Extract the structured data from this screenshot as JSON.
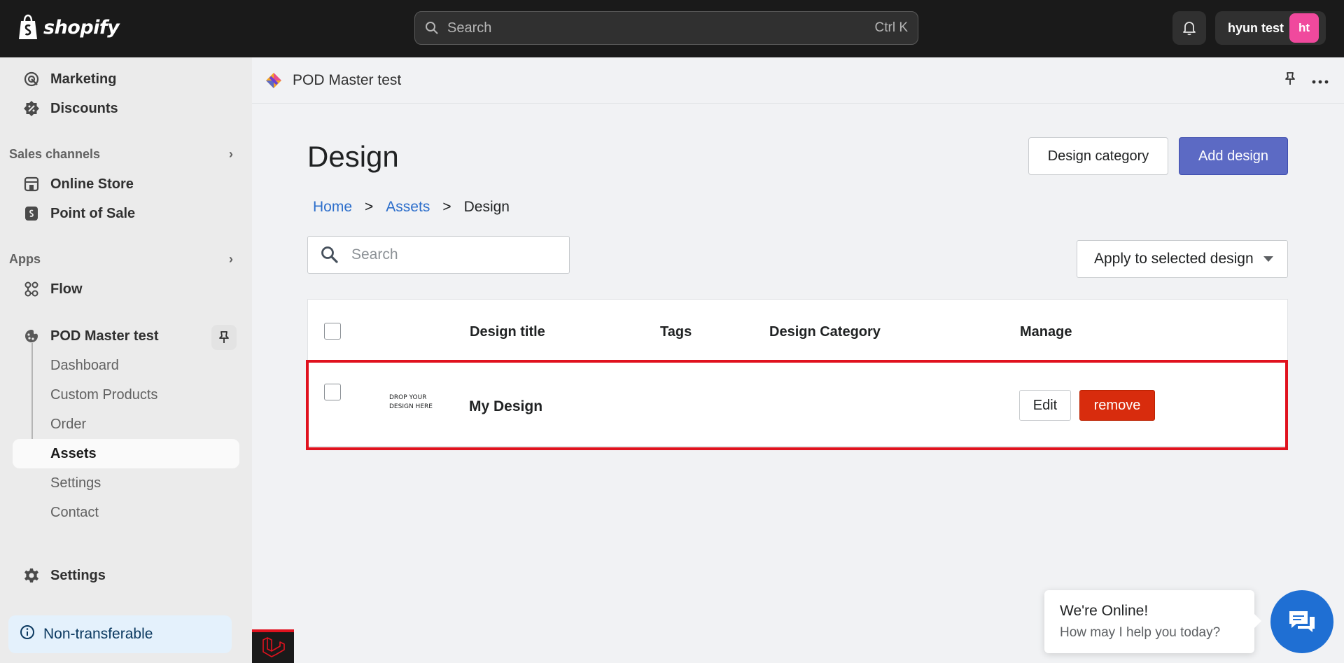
{
  "topbar": {
    "brand": "shopify",
    "search_placeholder": "Search",
    "search_shortcut": "Ctrl K",
    "user_name": "hyun test",
    "user_initials": "ht",
    "avatar_color": "#f0499d"
  },
  "sidebar": {
    "items_top": [
      {
        "label": "Marketing",
        "icon": "target-icon"
      },
      {
        "label": "Discounts",
        "icon": "discount-icon"
      }
    ],
    "sales_channels_label": "Sales channels",
    "sales_channels": [
      {
        "label": "Online Store",
        "icon": "store-icon"
      },
      {
        "label": "Point of Sale",
        "icon": "pos-icon"
      }
    ],
    "apps_label": "Apps",
    "apps": [
      {
        "label": "Flow",
        "icon": "flow-icon"
      },
      {
        "label": "POD Master test",
        "icon": "app-icon"
      }
    ],
    "app_subitems": [
      "Dashboard",
      "Custom Products",
      "Order",
      "Assets",
      "Settings",
      "Contact"
    ],
    "active_subitem": "Assets",
    "settings_label": "Settings",
    "non_transferable_label": "Non-transferable"
  },
  "app_bar": {
    "title": "POD Master test"
  },
  "page": {
    "title": "Design",
    "design_category_button": "Design category",
    "add_design_button": "Add design",
    "breadcrumb": [
      "Home",
      "Assets",
      "Design"
    ],
    "breadcrumb_sep": ">",
    "search_placeholder": "Search",
    "bulk_action_label": "Apply to selected design"
  },
  "table": {
    "columns": [
      "Design title",
      "Tags",
      "Design Category",
      "Manage"
    ],
    "rows": [
      {
        "thumbnail_text_line1": "DROP YOUR",
        "thumbnail_text_line2": "DESIGN HERE",
        "title": "My Design",
        "tags": "",
        "category": "",
        "edit_label": "Edit",
        "remove_label": "remove"
      }
    ]
  },
  "chat": {
    "status": "We're Online!",
    "prompt": "How may I help you today?"
  },
  "colors": {
    "primary": "#5c6ac4",
    "danger": "#d82c0d",
    "highlight": "#e0121e",
    "link": "#2c6ecb",
    "chat": "#1f6fd3"
  }
}
